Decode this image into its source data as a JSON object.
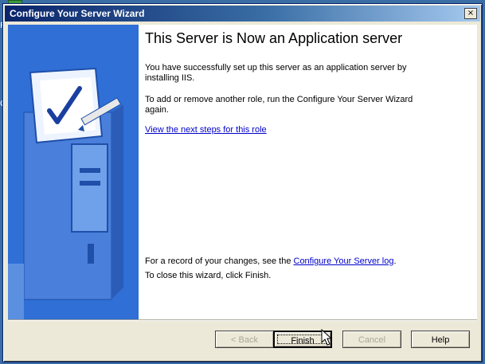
{
  "desktop": {
    "icon_partial_r": "R",
    "icon_partial_c": "Co"
  },
  "window": {
    "title": "Configure Your Server Wizard",
    "close_glyph": "×"
  },
  "content": {
    "heading": "This Server is Now an Application server",
    "para1": "You have successfully set up this server as an application server by installing IIS.",
    "para2": "To add or remove another role, run the Configure Your Server Wizard again.",
    "next_steps_link": "View the next steps for this role",
    "record_prefix": "For a record of your changes, see the ",
    "record_link": "Configure Your Server log",
    "record_suffix": ".",
    "close_text": "To close this wizard, click Finish."
  },
  "buttons": {
    "back": "< Back",
    "finish": "Finish",
    "cancel": "Cancel",
    "help": "Help"
  },
  "colors": {
    "titlebar_start": "#0a246a",
    "panel_blue": "#2f6fd6",
    "link": "#0000cc"
  },
  "icons": {
    "wizard_illustration": "server-with-checklist",
    "cursor": "arrow-pointer"
  }
}
